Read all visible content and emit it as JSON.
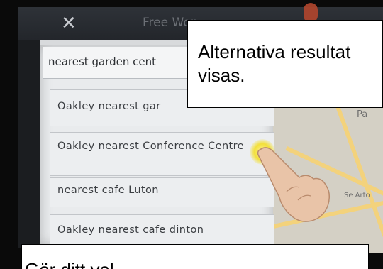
{
  "topbar": {
    "title": "Free Wor"
  },
  "search": {
    "query": "nearest garden cent"
  },
  "results": [
    {
      "label": "Oakley nearest gar"
    },
    {
      "label": "Oakley nearest Conference Centre"
    },
    {
      "label": "nearest cafe Luton"
    },
    {
      "label": "Oakley nearest cafe dinton"
    }
  ],
  "map": {
    "label_1": "Pa",
    "label_2": "Se Arto"
  },
  "callouts": {
    "top": "Alternativa resultat\nvisas.",
    "bottom": "Gör ditt val"
  },
  "colors": {
    "highlight": "#f3e03a",
    "screen_background": "#e9ebed"
  }
}
